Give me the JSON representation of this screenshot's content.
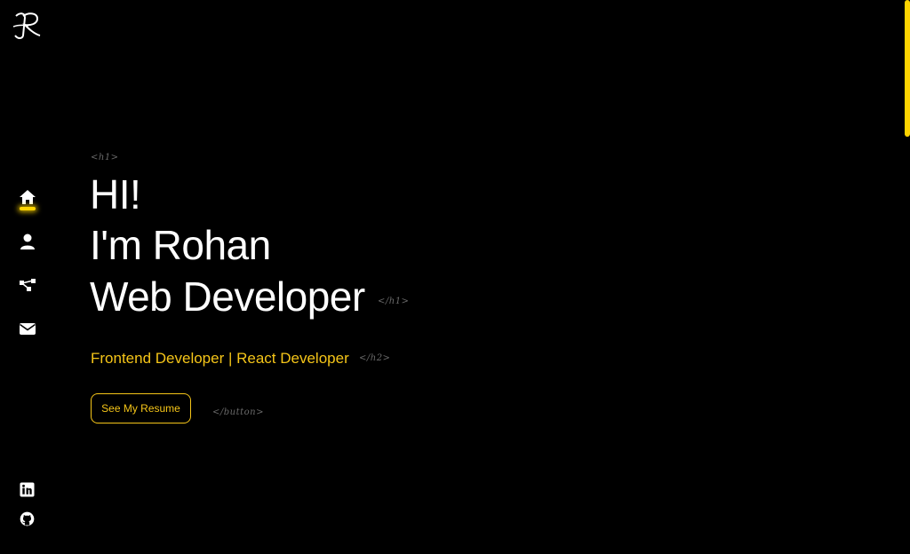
{
  "logo": {
    "text": "R",
    "icon": "logo-r-icon"
  },
  "sidebar": {
    "nav": [
      {
        "name": "home",
        "icon": "home-icon",
        "active": true
      },
      {
        "name": "about",
        "icon": "user-icon",
        "active": false
      },
      {
        "name": "skills",
        "icon": "network-icon",
        "active": false
      },
      {
        "name": "contact",
        "icon": "envelope-icon",
        "active": false
      }
    ],
    "social": [
      {
        "name": "linkedin",
        "icon": "linkedin-icon"
      },
      {
        "name": "github",
        "icon": "github-icon"
      }
    ]
  },
  "hero": {
    "tag_h1_open": "<h1>",
    "line1": "HI!",
    "line2": "I'm Rohan",
    "line3": "Web Developer",
    "tag_h1_close": "</h1>",
    "subtitle": "Frontend Developer | React Developer",
    "tag_h2_close": "</h2>",
    "button_label": "See My Resume",
    "tag_button_close": "</button>"
  },
  "colors": {
    "background": "#000000",
    "accent": "#f5c518",
    "text": "#ffffff",
    "tag": "#6a6a6a"
  }
}
